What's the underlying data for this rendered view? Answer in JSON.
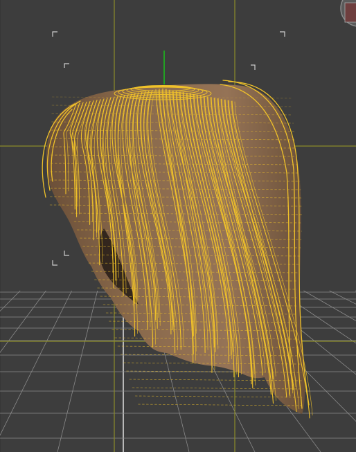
{
  "viewport": {
    "view": "perspective",
    "mode": "wireframe-on-shaded",
    "selected_object": "hair-mesh"
  },
  "colors": {
    "background": "#3d3d3d",
    "grid_major": "#2f2f2f",
    "floor_grid": "#8a8a8a",
    "floor_center": "#d8d8d8",
    "camera_axis": "#8c8c2a",
    "gizmo_y": "#19c21b",
    "wire": "#f0c22a",
    "hair_base": "#8a6a4c",
    "hair_shadow": "#5a4330",
    "safe_frame": "#cfcfcf"
  },
  "icons": {
    "gizmo": "view-cube-icon"
  }
}
